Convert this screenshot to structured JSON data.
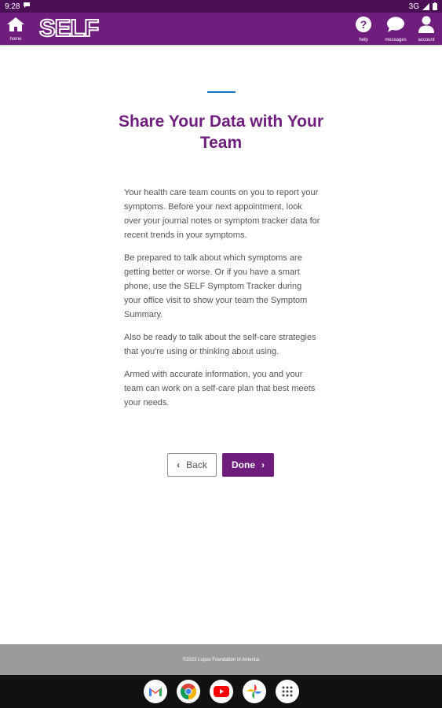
{
  "status_bar": {
    "time": "9:28",
    "network": "3G"
  },
  "header": {
    "logo_text": "SELF",
    "home_label": "home",
    "help_label": "help",
    "messages_label": "messages",
    "account_label": "account",
    "header_color": "#6f1e7d"
  },
  "main": {
    "title": "Share Your Data with Your Team",
    "paragraphs": [
      "Your health care team counts on you to report your symptoms. Before your next appointment, look over your journal notes or symptom tracker data for recent trends in your symptoms.",
      "Be prepared to talk about which symptoms are getting better or worse. Or if you have a smart phone, use the SELF Symptom Tracker during your office visit to show your team the Symptom Summary.",
      "Also be ready to talk about the self-care strategies that you're using or thinking about using.",
      "Armed with accurate information, you and your team can work on a self-care plan that best meets your needs."
    ],
    "back_label": "Back",
    "done_label": "Done"
  },
  "footer": {
    "copyright": "©2023 Lupus Foundation of America"
  },
  "dock": {
    "apps": [
      "gmail-icon",
      "chrome-icon",
      "youtube-icon",
      "photos-icon",
      "app-drawer-icon"
    ]
  }
}
